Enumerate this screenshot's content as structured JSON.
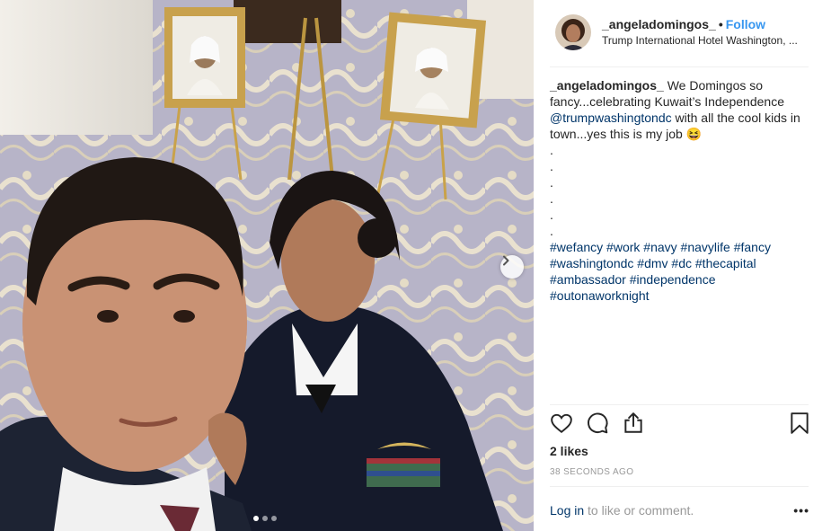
{
  "post": {
    "username": "_angeladomingos_",
    "separator": "•",
    "follow_label": "Follow",
    "location": "Trump International Hotel Washington, ...",
    "caption": {
      "user": "_angeladomingos_",
      "text_1": " We Domingos so fancy...celebrating Kuwait’s Independence ",
      "mention": "@trumpwashingtondc",
      "text_2": " with all the cool kids in town...yes this is my job 😆",
      "dots": [
        ".",
        ".",
        ".",
        ".",
        ".",
        "."
      ],
      "hashtags": [
        "#wefancy",
        "#work",
        "#navy",
        "#navylife",
        "#fancy",
        "#washingtondc",
        "#dmv",
        "#dc",
        "#thecapital",
        "#ambassador",
        "#independence",
        "#outonaworknight"
      ]
    },
    "likes": "2 likes",
    "timestamp": "38 SECONDS AGO",
    "login_label": "Log in",
    "comment_prompt": " to like or comment.",
    "more_label": "•••",
    "carousel": {
      "total_slides": 3,
      "active_slide": 1
    }
  },
  "icons": [
    "heart-icon",
    "comment-icon",
    "share-icon",
    "bookmark-icon",
    "chevron-right-icon",
    "more-options-icon"
  ],
  "colors": {
    "accent": "#3897f0",
    "link": "#003569",
    "muted": "#999999",
    "text": "#262626"
  }
}
